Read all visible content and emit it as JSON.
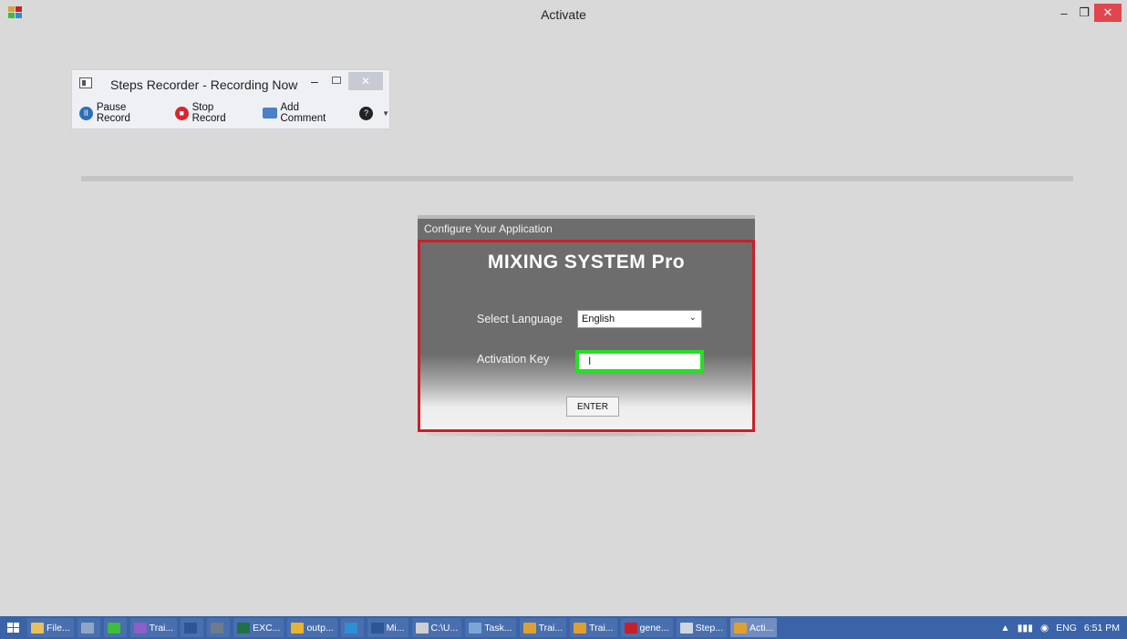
{
  "window": {
    "title": "Activate",
    "minimize_glyph": "–",
    "restore_glyph": "❐",
    "close_glyph": "✕"
  },
  "steps_recorder": {
    "title": "Steps Recorder - Recording Now",
    "minimize_glyph": "–",
    "close_glyph": "✕",
    "pause_label": "Pause Record",
    "stop_label": "Stop Record",
    "comment_label": "Add Comment",
    "help_glyph": "?",
    "dropdown_glyph": "▼"
  },
  "config": {
    "header": "Configure Your Application",
    "brand": "MIXING SYSTEM Pro",
    "language_label": "Select Language",
    "language_value": "English",
    "chevron_glyph": "⌄",
    "key_label": "Activation Key",
    "key_value": "I",
    "enter_label": "ENTER"
  },
  "taskbar": {
    "items": [
      {
        "label": "File...",
        "color": "#e8c15a"
      },
      {
        "label": "",
        "color": "#8fa6c8"
      },
      {
        "label": "",
        "color": "#3cbd3c"
      },
      {
        "label": "Trai...",
        "color": "#8b5fc7"
      },
      {
        "label": "",
        "color": "#2b5797"
      },
      {
        "label": "",
        "color": "#6d7b8c"
      },
      {
        "label": "EXC...",
        "color": "#1f7244"
      },
      {
        "label": "outp...",
        "color": "#e8b32f"
      },
      {
        "label": "",
        "color": "#2d8fd5"
      },
      {
        "label": "Mi...",
        "color": "#2b5797"
      },
      {
        "label": "C:\\U...",
        "color": "#cfcfcf"
      },
      {
        "label": "Task...",
        "color": "#7aa7d8"
      },
      {
        "label": "Trai...",
        "color": "#e0a030"
      },
      {
        "label": "Trai...",
        "color": "#e0a030"
      },
      {
        "label": "gene...",
        "color": "#c8202a"
      },
      {
        "label": "Step...",
        "color": "#cfd6e0"
      },
      {
        "label": "Acti...",
        "color": "#e0a030"
      }
    ],
    "tray_language": "ENG",
    "clock": "6:51 PM",
    "tray_glyphs": "▲"
  }
}
